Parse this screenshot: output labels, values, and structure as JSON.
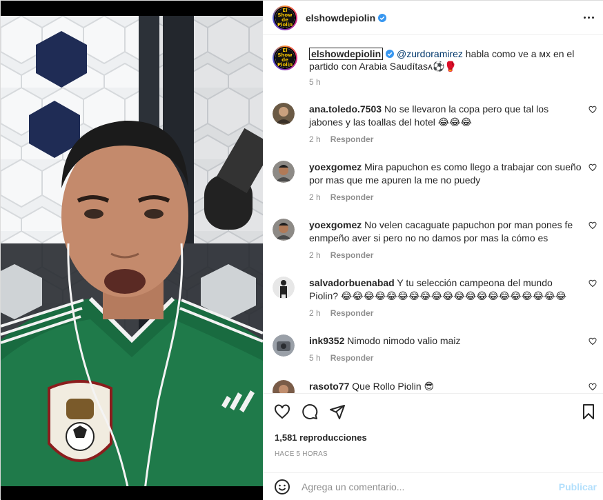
{
  "post": {
    "username": "elshowdepiolin",
    "logo_text": "El Show de Piolin"
  },
  "caption": {
    "username": "elshowdepiolin",
    "mention": "@zurdoramirez",
    "text": " habla como ve a ᴍx en el partido con Arabia Saudítasᴀ⚽🥊",
    "time": "5 h"
  },
  "comments": [
    {
      "user": "ana.toledo.7503",
      "text": "No se llevaron la copa pero que tal los jabones y las toallas del hotel 😂😂😂",
      "time": "2 h",
      "reply": "Responder"
    },
    {
      "user": "yoexgomez",
      "text": "Mira papuchon es como llego a trabajar con sueño por mas que me apuren la me no puedy",
      "time": "2 h",
      "reply": "Responder"
    },
    {
      "user": "yoexgomez",
      "text": "No velen cacaguate papuchon por man pones fe enmpeño aver si pero no no damos por mas la cómo es",
      "time": "2 h",
      "reply": "Responder"
    },
    {
      "user": "salvadorbuenabad",
      "text": "Y tu selección campeona del mundo Piolin? 😂😂😂😂😂😂😂😂😂😂😂😂😂😂😂😂😂😂😂😂",
      "time": "2 h",
      "reply": "Responder"
    },
    {
      "user": "ink9352",
      "text": "Nimodo nimodo valio maiz",
      "time": "5 h",
      "reply": "Responder"
    },
    {
      "user": "rasoto77",
      "text": "Que Rollo Piolin 😎",
      "time": "",
      "reply": ""
    }
  ],
  "actions": {
    "views": "1,581 reproducciones",
    "time_ago": "HACE 5 HORAS",
    "comment_placeholder": "Agrega un comentario...",
    "publish": "Publicar"
  },
  "colors": {
    "verified": "#3897f0",
    "link": "#00376b",
    "publish": "#b2dffc",
    "jersey": "#1f7a4a"
  }
}
